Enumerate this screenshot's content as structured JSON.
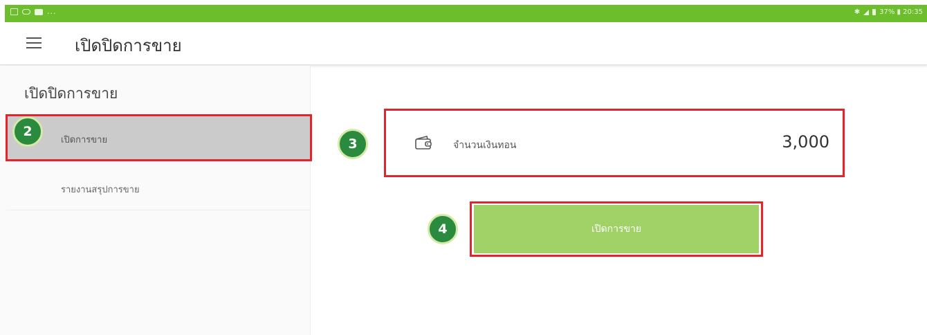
{
  "status_bar": {
    "icons_left": [
      "image-icon",
      "link-icon",
      "youtube-icon"
    ],
    "more_indicator": "...",
    "right_text": "37% ▮ 20:35",
    "accent_color": "#6cbe2c"
  },
  "app_bar": {
    "title": "เปิดปิดการขาย"
  },
  "sidebar": {
    "title": "เปิดปิดการขาย",
    "items": [
      {
        "label": "เปิดการขาย",
        "selected": true
      },
      {
        "label": "รายงานสรุปการขาย",
        "selected": false
      }
    ]
  },
  "main": {
    "cash_label": "จำนวนเงินทอน",
    "cash_value": "3,000",
    "open_button_label": "เปิดการขาย",
    "button_color": "#a0d267"
  },
  "annotations": {
    "badges": [
      "2",
      "3",
      "4"
    ],
    "highlight_color": "#e4232b",
    "badge_color": "#2a8a3e"
  }
}
